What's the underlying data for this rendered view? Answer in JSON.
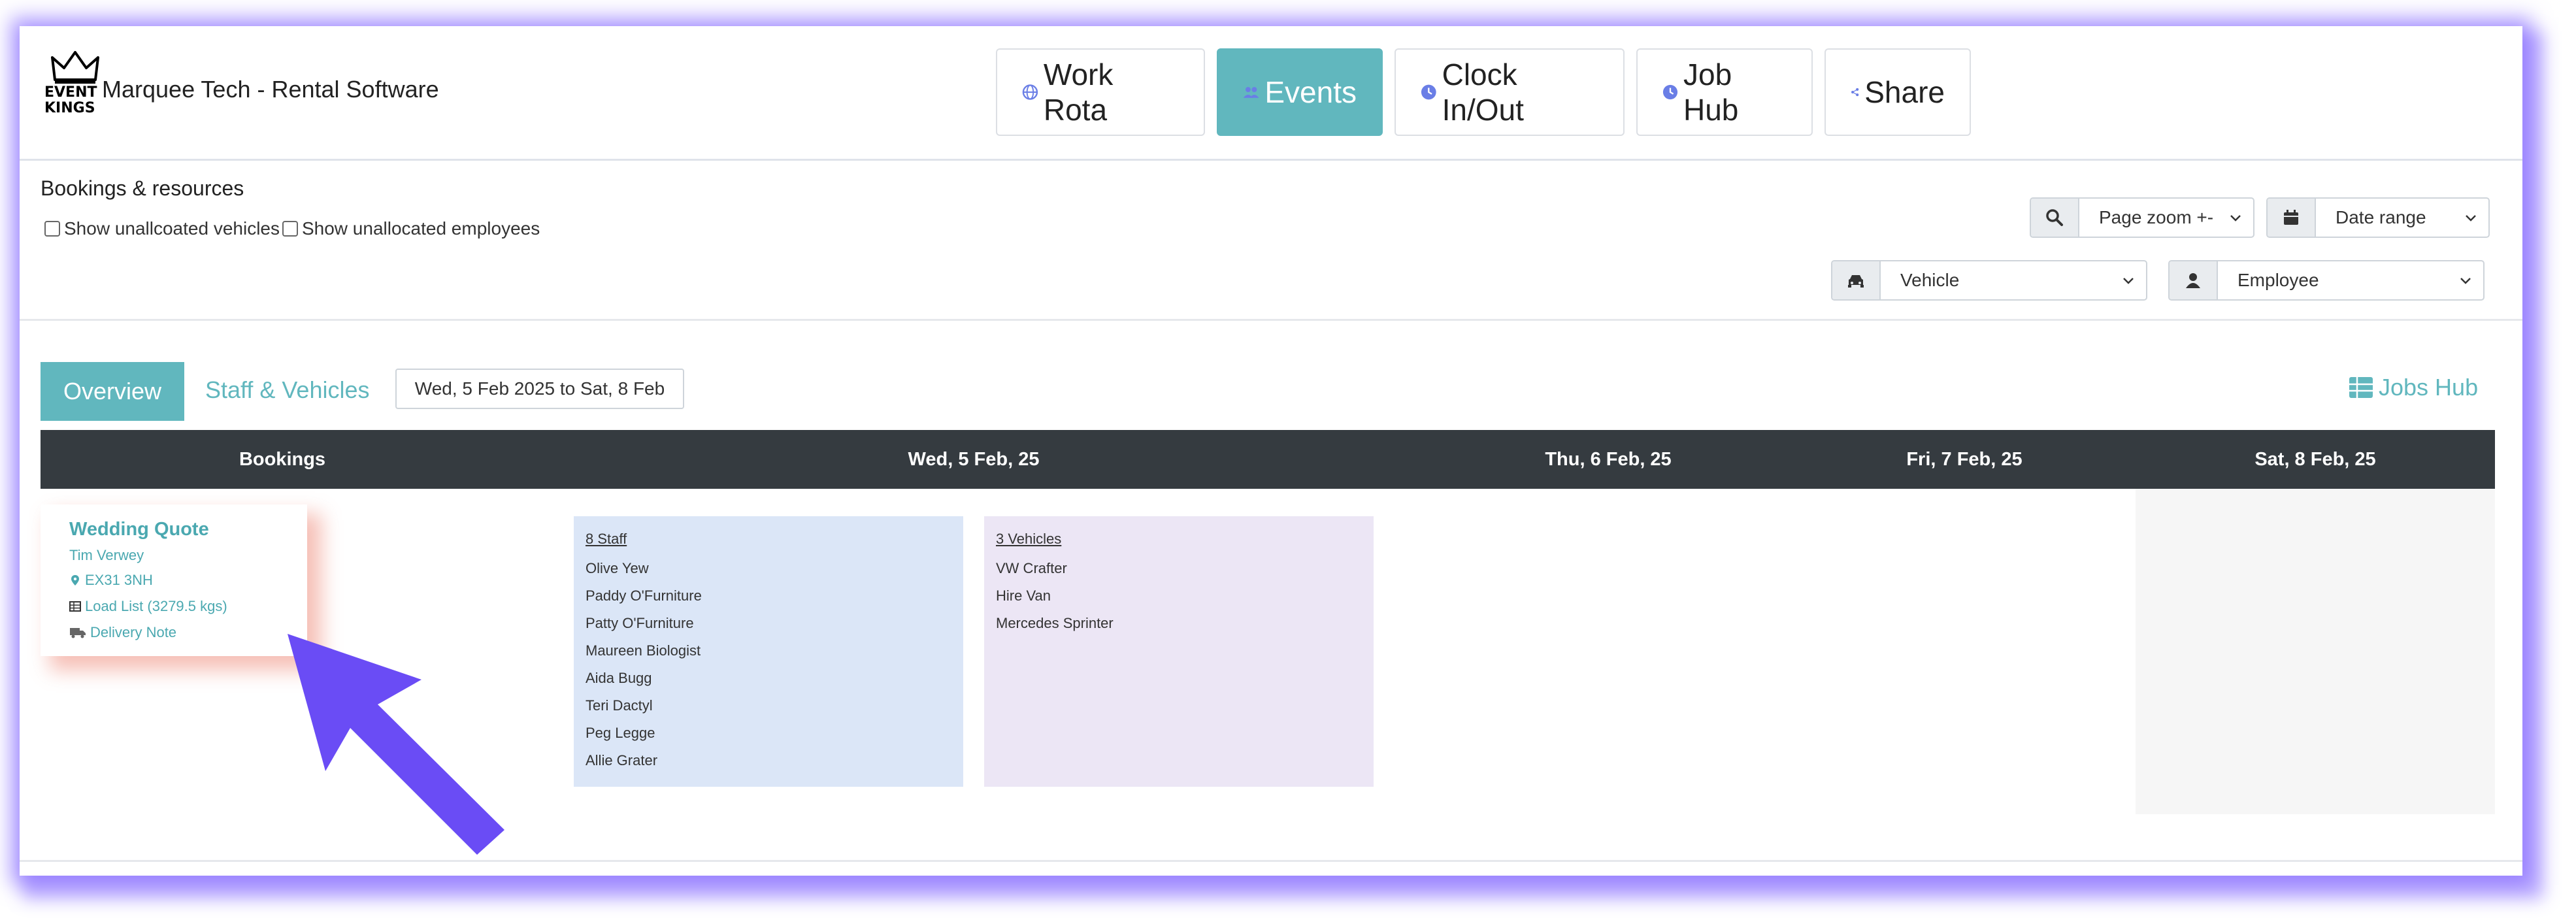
{
  "header": {
    "logo_line1": "EVENT",
    "logo_line2": "KINGS",
    "app_title": "Marquee Tech - Rental Software",
    "nav": [
      {
        "label": "Work Rota",
        "icon": "globe-icon",
        "active": false
      },
      {
        "label": "Events",
        "icon": "users-icon",
        "active": true
      },
      {
        "label": "Clock In/Out",
        "icon": "clock-icon",
        "active": false
      },
      {
        "label": "Job Hub",
        "icon": "clock-icon",
        "active": false
      },
      {
        "label": "Share",
        "icon": "share-icon",
        "active": false
      }
    ]
  },
  "resources": {
    "title": "Bookings & resources",
    "show_vehicles_label": "Show unallcoated vehicles",
    "show_employees_label": "Show unallocated employees",
    "page_zoom": "Page zoom +-",
    "date_range": "Date range",
    "vehicle": "Vehicle",
    "employee": "Employee"
  },
  "tabs": {
    "overview": "Overview",
    "staff_vehicles": "Staff & Vehicles",
    "date_span": "Wed, 5 Feb 2025 to Sat, 8 Feb",
    "jobs_hub": "Jobs Hub"
  },
  "table": {
    "columns": [
      "Bookings",
      "Wed, 5 Feb, 25",
      "Thu, 6 Feb, 25",
      "Fri, 7 Feb, 25",
      "Sat, 8 Feb, 25"
    ]
  },
  "booking": {
    "title": "Wedding Quote",
    "client": "Tim Verwey",
    "postcode": "EX31 3NH",
    "load_list": "Load List (3279.5 kgs)",
    "delivery_note": "Delivery Note"
  },
  "staff": {
    "heading": "8 Staff",
    "names": [
      "Olive Yew",
      "Paddy O'Furniture",
      "Patty O'Furniture",
      "Maureen Biologist",
      "Aida Bugg",
      "Teri Dactyl",
      "Peg Legge",
      "Allie Grater"
    ]
  },
  "vehicles": {
    "heading": "3 Vehicles",
    "names": [
      "VW Crafter",
      "Hire Van",
      "Mercedes Sprinter"
    ]
  },
  "colors": {
    "accent": "#61b7be",
    "table_header": "#353b40",
    "staff_panel": "#dbe6f7",
    "vehicle_panel": "#ece6f5",
    "pointer": "#6a4cf5"
  }
}
